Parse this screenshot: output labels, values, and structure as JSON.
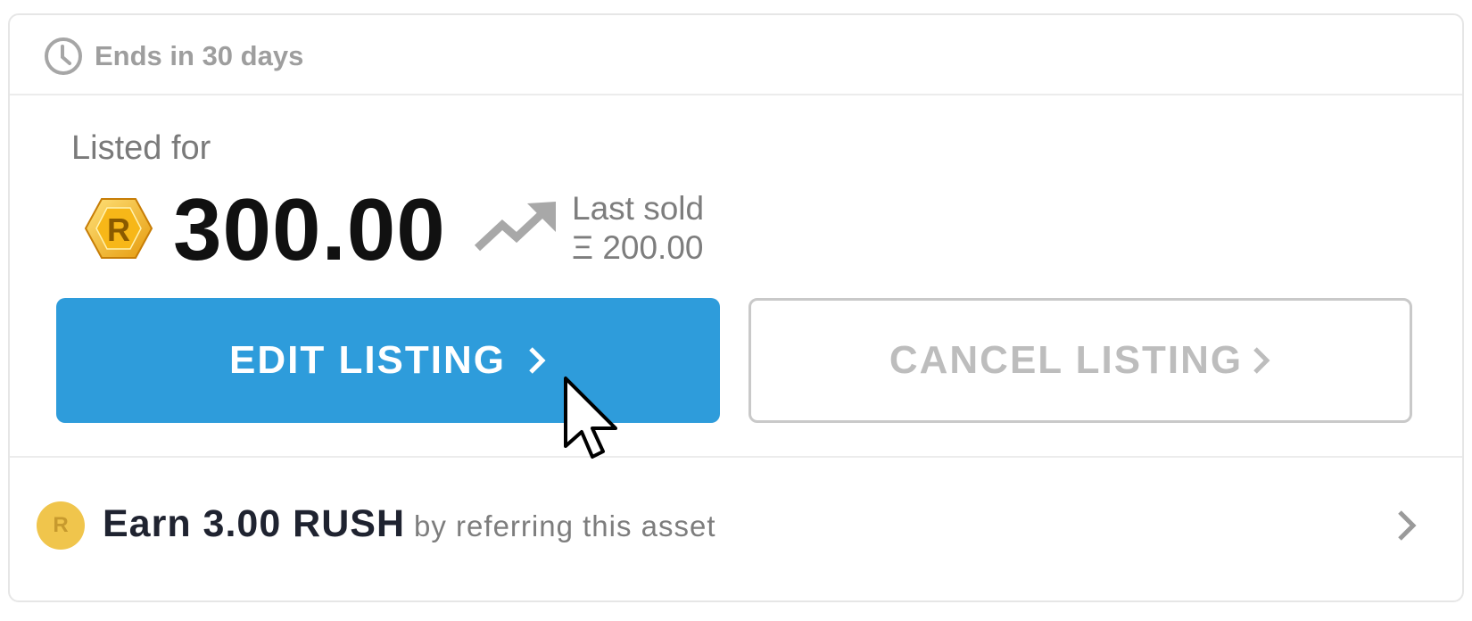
{
  "header": {
    "ends_text": "Ends in 30 days",
    "icon": "clock-icon"
  },
  "listing": {
    "listed_label": "Listed for",
    "price": "300.00",
    "currency_icon": "rush-coin-icon",
    "trend_icon": "trending-up-icon",
    "last_sold_label": "Last sold",
    "last_sold_price": "Ξ 200.00"
  },
  "actions": {
    "edit_label": "EDIT LISTING",
    "cancel_label": "CANCEL LISTING"
  },
  "referral": {
    "badge": "R",
    "earn_text": "Earn 3.00 RUSH",
    "sub_text": "by referring this asset"
  },
  "colors": {
    "primary": "#2e9cdb",
    "gold": "#f0c54c",
    "muted": "#9e9e9e"
  }
}
